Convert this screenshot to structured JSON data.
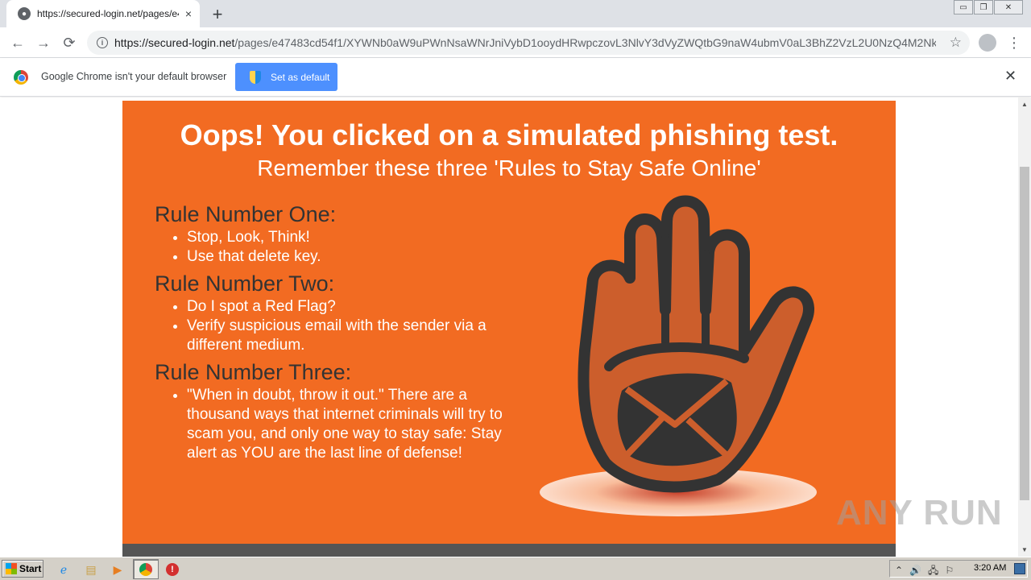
{
  "browser": {
    "tab": {
      "title": "https://secured-login.net/pages/e47",
      "close_label": "×"
    },
    "new_tab_label": "+",
    "window_controls": {
      "minimize": "▭",
      "restore": "❐",
      "close": "✕"
    },
    "nav": {
      "back": "←",
      "forward": "→",
      "reload": "⟳"
    },
    "address": {
      "host": "https://secured-login.net",
      "path": "/pages/e47483cd54f1/XYWNb0aW9uPWnNsaWNrJniVybD1ooydHRwpczovL3NlvY3dVyZWQtbG9naW4ubmV0aL3BhZ2VzL2U0NzQ4M2Nk...",
      "star": "☆"
    },
    "menu_label": "⋮"
  },
  "infobar": {
    "message": "Google Chrome isn't your default browser",
    "button_label": "Set as default",
    "close_label": "✕"
  },
  "page": {
    "headline": "Oops! You clicked on a simulated phishing test.",
    "subheadline": "Remember these three 'Rules to Stay Safe Online'",
    "rules": [
      {
        "title": "Rule Number One:",
        "items": [
          "Stop, Look, Think!",
          "Use that delete key."
        ]
      },
      {
        "title": "Rule Number Two:",
        "items": [
          "Do I spot a Red Flag?",
          "Verify suspicious email with the sender via a different medium."
        ]
      },
      {
        "title": "Rule Number Three:",
        "items": [
          "\"When in doubt, throw it out.\" There are a thousand ways that internet criminals will try to scam you, and only one way to stay safe: Stay alert as YOU are the last line of defense!"
        ]
      }
    ],
    "colors": {
      "banner": "#f26b22",
      "hand_fill": "#cc5e2c",
      "hand_outline": "#333333",
      "footer_bar": "#555555"
    }
  },
  "watermark": "ANY RUN",
  "taskbar": {
    "start_label": "Start",
    "icons": [
      "ie-icon",
      "explorer-icon",
      "media-player-icon",
      "chrome-icon",
      "stop-icon"
    ],
    "tray_icons": "⌃🔊🖧⚐",
    "clock": "3:20 AM"
  }
}
